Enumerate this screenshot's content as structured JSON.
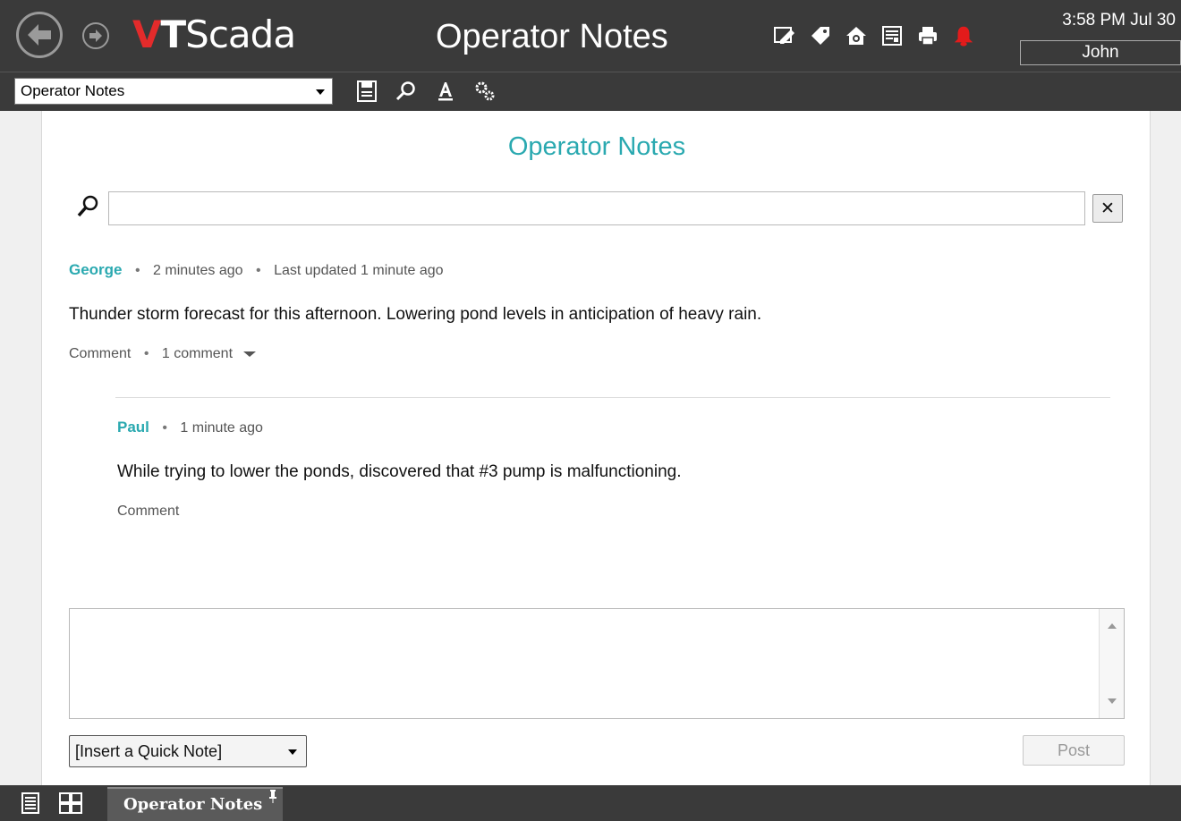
{
  "header": {
    "logo": {
      "v": "V",
      "t": "T",
      "rest": "Scada"
    },
    "title": "Operator Notes",
    "time": "3:58 PM  Jul 30",
    "user": "John",
    "icons": [
      "edit-display-icon",
      "tag-icon",
      "home-settings-icon",
      "report-icon",
      "print-icon",
      "alarm-bell-icon"
    ],
    "alarm_color": "#e31b1b"
  },
  "toolbar": {
    "page_select_value": "Operator Notes",
    "icons": [
      "save-icon",
      "search-icon",
      "text-format-icon",
      "settings-gears-icon"
    ]
  },
  "panel": {
    "title": "Operator Notes",
    "accent_color": "#2aa9b0",
    "search": {
      "value": "",
      "clear_label": "✕"
    },
    "note": {
      "author": "George",
      "time": "2 minutes ago",
      "updated": "Last updated 1 minute ago",
      "dot": "•",
      "body": "Thunder storm forecast for this afternoon. Lowering pond levels in anticipation of heavy rain.",
      "comment_label": "Comment",
      "comment_count": "1 comment"
    },
    "reply": {
      "author": "Paul",
      "time": "1 minute ago",
      "dot": "•",
      "body": "While trying to lower the ponds, discovered that #3 pump is malfunctioning.",
      "comment_label": "Comment"
    },
    "compose": {
      "value": ""
    },
    "quick_note": "[Insert a Quick Note]",
    "post_label": "Post"
  },
  "taskbar": {
    "tab_label": "Operator Notes",
    "pin": "📌"
  }
}
